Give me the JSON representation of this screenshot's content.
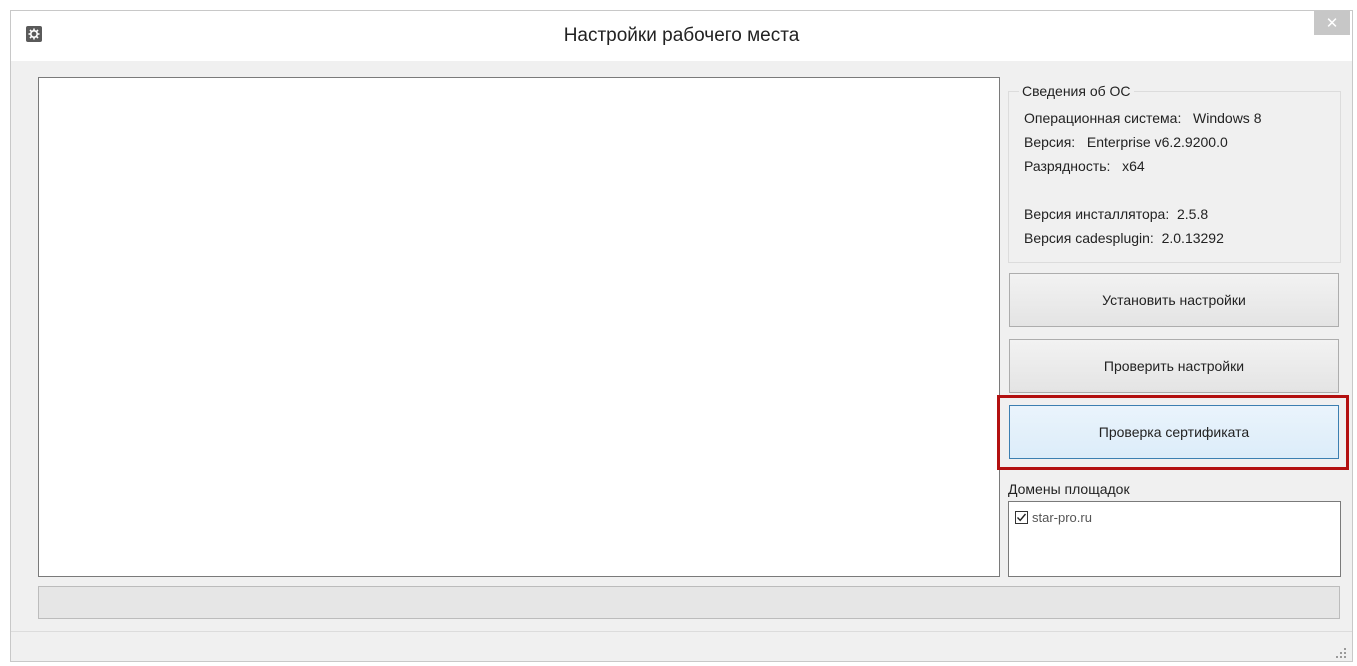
{
  "window": {
    "title": "Настройки рабочего места",
    "close_glyph": "✕",
    "icon": "gear-icon"
  },
  "os_info": {
    "legend": "Сведения об ОС",
    "os_line": "Операционная система:   Windows 8",
    "version_line": "Версия:   Enterprise v6.2.9200.0",
    "bitness_line": "Разрядность:   x64",
    "installer_line": "Версия инсталлятора:  2.5.8",
    "cadesplugin_line": "Версия cadesplugin:  2.0.13292"
  },
  "buttons": {
    "install": "Установить настройки",
    "check": "Проверить настройки",
    "certificate": "Проверка сертификата"
  },
  "domains": {
    "label": "Домены площадок",
    "items": [
      {
        "name": "star-pro.ru",
        "checked": true
      }
    ]
  },
  "colors": {
    "highlight": "#b31010",
    "focus_border": "#3c7fb1"
  }
}
